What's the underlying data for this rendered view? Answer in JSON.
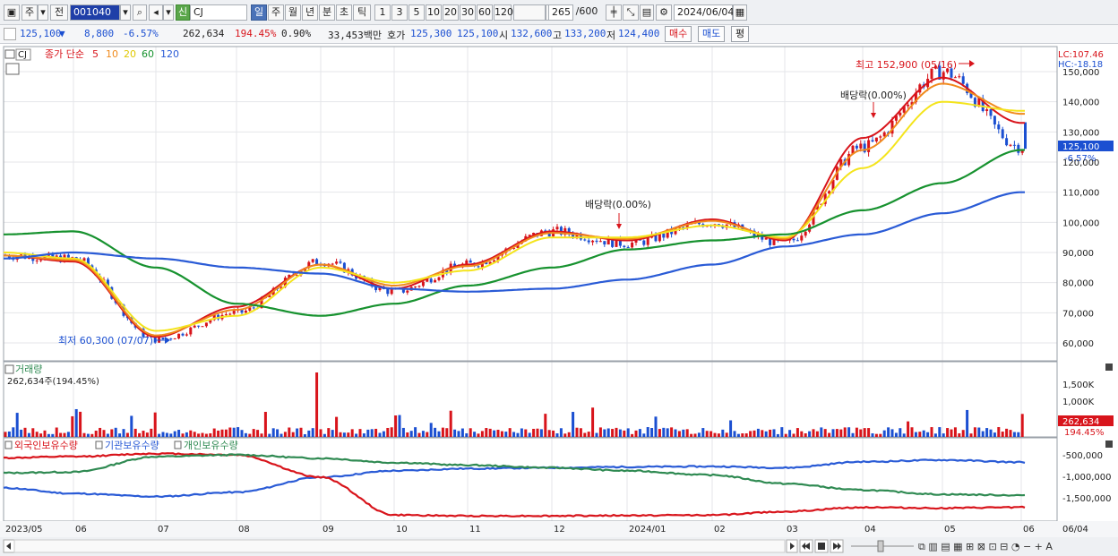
{
  "toolbar": {
    "market": "주",
    "prev": "전",
    "code": "001040",
    "type_badge": "신",
    "name": "CJ",
    "periods": [
      "일",
      "주",
      "월",
      "년",
      "분",
      "초",
      "틱"
    ],
    "minutes": [
      "1",
      "3",
      "5",
      "10",
      "20",
      "30",
      "60",
      "120"
    ],
    "count": "265",
    "count_total": "/600",
    "date": "2024/06/04"
  },
  "quote": {
    "price": "125,100",
    "direction": "▼",
    "change": "8,800",
    "change_pct": "-6.57%",
    "volume": "262,634",
    "volume_pct": "194.45%",
    "turnover_pct": "0.90%",
    "amount": "33,453백만",
    "ask_label": "호가",
    "ask": "125,300",
    "bid": "125,100",
    "open_label": "시",
    "open": "132,600",
    "high_label": "고",
    "high": "133,200",
    "low_label": "저",
    "low": "124,400",
    "buy": "매수",
    "sell": "매도",
    "eval": "평"
  },
  "price_panel": {
    "symbol": "CJ",
    "legend_title": "종가 단순",
    "ma_labels": [
      "5",
      "10",
      "20",
      "60",
      "120"
    ],
    "lc": "LC:107.46",
    "hc": "HC:-18.18",
    "current_tag": "125,100",
    "current_pct": "-6.57%",
    "high_note": "최고 152,900 (05/16)",
    "low_note": "최저 60,300 (07/07)",
    "dividend1": "배당락(0.00%)",
    "dividend2": "배당락(0.00%)"
  },
  "volume_panel": {
    "title": "거래량",
    "value": "262,634주(194.45%)",
    "axis": [
      "1,500K",
      "1,000K"
    ],
    "tag": "262,634",
    "tag_pct": "194.45%"
  },
  "holdings_panel": {
    "legend": [
      "외국인보유수량",
      "기관보유수량",
      "개인보유수량"
    ],
    "axis": [
      "-500,000",
      "-1,000,000",
      "-1,500,000"
    ]
  },
  "x_axis": [
    "2023/05",
    "06",
    "07",
    "08",
    "09",
    "10",
    "11",
    "12",
    "2024/01",
    "02",
    "03",
    "04",
    "05",
    "06"
  ],
  "x_right": "06/04",
  "colors": {
    "up": "#d8141b",
    "down": "#1b4fd1",
    "ma5": "#d8141b",
    "ma10": "#f08a1c",
    "ma20": "#f4e41c",
    "ma60": "#17922f",
    "ma120": "#2a5bd6",
    "foreign": "#2a5bd6",
    "institution": "#d8141b",
    "individual": "#2f8a52"
  },
  "chart_data": {
    "type": "line",
    "title": "CJ",
    "ylim": [
      55000,
      155000
    ],
    "yticks": [
      60000,
      70000,
      80000,
      90000,
      100000,
      110000,
      120000,
      130000,
      140000,
      150000
    ],
    "x_labels": [
      "2023/05",
      "06",
      "07",
      "08",
      "09",
      "10",
      "11",
      "12",
      "2024/01",
      "02",
      "03",
      "04",
      "05",
      "06"
    ],
    "close_anchor_points": [
      {
        "label": "2023/05",
        "value": 89000
      },
      {
        "label": "06",
        "value": 88000
      },
      {
        "label": "07",
        "value": 61000
      },
      {
        "label": "08",
        "value": 70000
      },
      {
        "label": "09",
        "value": 87000
      },
      {
        "label": "10",
        "value": 77000
      },
      {
        "label": "11",
        "value": 86000
      },
      {
        "label": "12",
        "value": 97000
      },
      {
        "label": "2024/01",
        "value": 93000
      },
      {
        "label": "02",
        "value": 100000
      },
      {
        "label": "03",
        "value": 93000
      },
      {
        "label": "04",
        "value": 125000
      },
      {
        "label": "05",
        "value": 150000
      },
      {
        "label": "06",
        "value": 125100
      }
    ],
    "series": [
      {
        "name": "5",
        "values": [
          89000,
          87000,
          62000,
          72000,
          86000,
          78000,
          86000,
          97000,
          94000,
          101000,
          94000,
          128000,
          148000,
          133000
        ]
      },
      {
        "name": "10",
        "values": [
          89000,
          87500,
          62500,
          71000,
          86000,
          79000,
          85500,
          96500,
          94500,
          100500,
          94500,
          124000,
          146000,
          136000
        ]
      },
      {
        "name": "20",
        "values": [
          90000,
          88000,
          64000,
          69000,
          85000,
          80000,
          84000,
          95000,
          95000,
          99000,
          95000,
          118000,
          140000,
          137000
        ]
      },
      {
        "name": "60",
        "values": [
          96000,
          97000,
          85000,
          73000,
          69000,
          73000,
          79000,
          85000,
          91000,
          94000,
          96000,
          104000,
          113000,
          124000
        ]
      },
      {
        "name": "120",
        "values": [
          88000,
          90000,
          88000,
          85000,
          83000,
          78000,
          77000,
          78000,
          81000,
          86000,
          92000,
          96000,
          103000,
          110000
        ]
      }
    ],
    "volume": {
      "name": "거래량",
      "peak_value": "262,634",
      "axis": [
        "1,500K",
        "1,000K"
      ]
    },
    "holdings": {
      "series": [
        {
          "name": "외국인보유수량",
          "values": [
            -1250000,
            -1380000,
            -1450000,
            -1350000,
            -1000000,
            -850000,
            -800000,
            -780000,
            -760000,
            -750000,
            -780000,
            -640000,
            -600000,
            -650000
          ]
        },
        {
          "name": "기관보유수량",
          "values": [
            -550000,
            -520000,
            -450000,
            -480000,
            -1000000,
            -1880000,
            -1900000,
            -1900000,
            -1890000,
            -1880000,
            -1800000,
            -1700000,
            -1720000,
            -1700000
          ]
        },
        {
          "name": "개인보유수량",
          "values": [
            -900000,
            -880000,
            -520000,
            -480000,
            -560000,
            -660000,
            -720000,
            -780000,
            -850000,
            -950000,
            -1150000,
            -1300000,
            -1400000,
            -1420000
          ]
        }
      ]
    }
  }
}
